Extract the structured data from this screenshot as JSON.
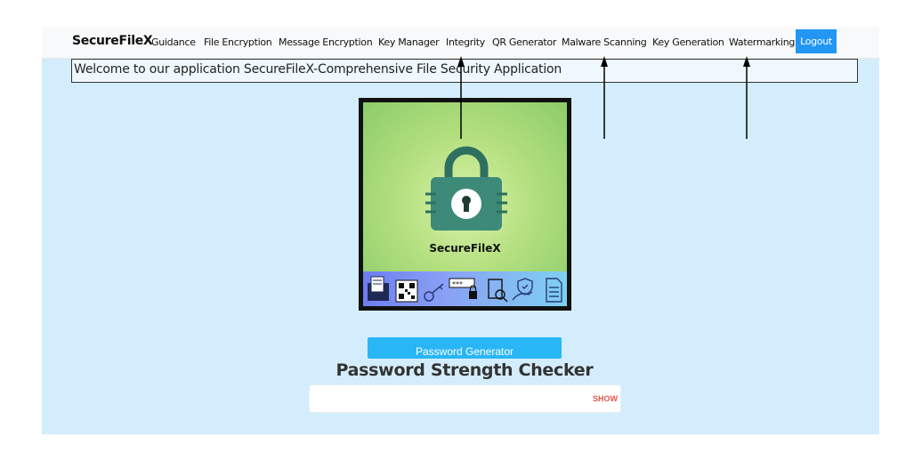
{
  "navbar": {
    "brand": "SecureFileX",
    "items": [
      {
        "label": "Guidance"
      },
      {
        "label": "File Encryption"
      },
      {
        "label": "Message Encryption"
      },
      {
        "label": "Key Manager"
      },
      {
        "label": "Integrity"
      },
      {
        "label": "QR Generator"
      },
      {
        "label": "Malware Scanning"
      },
      {
        "label": "Key Generation"
      },
      {
        "label": "Watermarking"
      }
    ],
    "logout_label": "Logout",
    "logout_color": "#2196f3"
  },
  "welcome_text": "Welcome to our application SecureFileX-Comprehensive File Security Application",
  "hero": {
    "label": "SecureFileX",
    "icons": [
      "folder-icon",
      "qr-code-icon",
      "key-icon",
      "password-lock-icon",
      "document-search-icon",
      "hand-shield-icon",
      "document-icon"
    ]
  },
  "password_generator": {
    "label": "Password Generator",
    "color": "#29b6f6"
  },
  "password_checker": {
    "title": "Password Strength Checker",
    "placeholder": "",
    "show_label": "SHOW",
    "show_color": "#e6574b"
  },
  "annotation_arrows": {
    "count": 3,
    "color": "#000000"
  }
}
